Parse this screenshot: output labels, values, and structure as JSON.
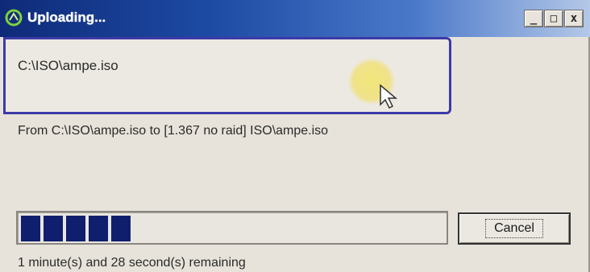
{
  "window": {
    "title": "Uploading...",
    "controls": {
      "minimize": "_",
      "maximize": "□",
      "close": "x"
    }
  },
  "transfer": {
    "file_path": "C:\\ISO\\ampe.iso",
    "from_to": "From C:\\ISO\\ampe.iso to [1.367 no raid] ISO\\ampe.iso",
    "remaining": "1 minute(s) and 28 second(s) remaining",
    "progress_fraction": 0.25
  },
  "buttons": {
    "cancel": "Cancel"
  },
  "icons": {
    "app": "upload-app-icon",
    "cursor": "mouse-pointer-icon"
  },
  "colors": {
    "title_bar": "#1c4aa3",
    "progress_block": "#0f1f6e",
    "focus_border": "#3d3aa6",
    "cursor_highlight": "#f2e67a"
  }
}
